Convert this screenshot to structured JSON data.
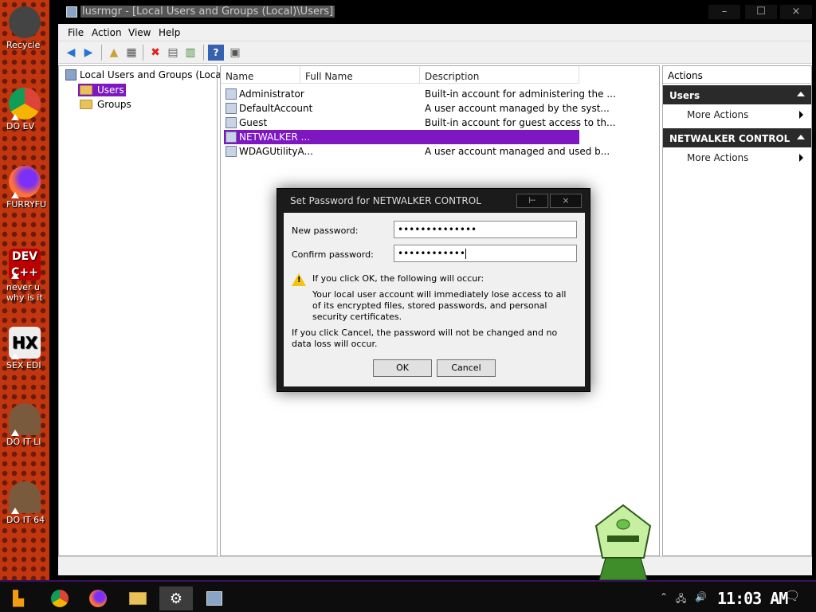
{
  "desktop": {
    "icons": [
      {
        "label": "Recycle"
      },
      {
        "label": "DO EV"
      },
      {
        "label": "FURRYFU"
      },
      {
        "label": "never u"
      },
      {
        "label": "why is it"
      },
      {
        "label": "SEX EDI"
      },
      {
        "label": "DO IT LI"
      },
      {
        "label": "DO IT 64"
      }
    ]
  },
  "window": {
    "title": "lusrmgr - [Local Users and Groups (Local)\\Users]",
    "controls": {
      "minimize": "–",
      "maximize": "☐",
      "close": "×"
    },
    "menu": [
      "File",
      "Action",
      "View",
      "Help"
    ],
    "toolbar_icons": [
      "back-arrow-icon",
      "forward-arrow-icon",
      "up-folder-icon",
      "show-hide-tree-icon",
      "delete-icon",
      "properties-icon",
      "export-list-icon",
      "help-icon",
      "show-hide-action-pane-icon"
    ]
  },
  "tree": {
    "root": "Local Users and Groups (Local)",
    "items": [
      {
        "label": "Users",
        "selected": true
      },
      {
        "label": "Groups",
        "selected": false
      }
    ]
  },
  "list": {
    "columns": [
      "Name",
      "Full Name",
      "Description"
    ],
    "rows": [
      {
        "name": "Administrator",
        "full_name": "",
        "description": "Built-in account for administering the ..."
      },
      {
        "name": "DefaultAccount",
        "full_name": "",
        "description": "A user account managed by the syst..."
      },
      {
        "name": "Guest",
        "full_name": "",
        "description": "Built-in account for guest access to th..."
      },
      {
        "name": "NETWALKER ...",
        "full_name": "",
        "description": "",
        "selected": true
      },
      {
        "name": "WDAGUtilityA...",
        "full_name": "",
        "description": "A user account managed and used b..."
      }
    ]
  },
  "actions": {
    "header": "Actions",
    "groups": [
      {
        "title": "Users",
        "item": "More Actions"
      },
      {
        "title": "NETWALKER CONTROL",
        "item": "More Actions"
      }
    ]
  },
  "dialog": {
    "title": "Set Password for NETWALKER CONTROL",
    "new_password_label": "New password:",
    "new_password_value": "••••••••••••••",
    "confirm_password_label": "Confirm password:",
    "confirm_password_value": "••••••••••••",
    "warning_heading": "If you click OK, the following will occur:",
    "warning_body": "Your local user account will immediately lose access to all of its encrypted files, stored passwords, and personal security certificates.",
    "cancel_note": "If you click Cancel, the password will not be changed and no data loss will occur.",
    "ok_label": "OK",
    "cancel_label": "Cancel",
    "help_btn": "⊢",
    "close_btn": "×"
  },
  "taskbar": {
    "clock": "11:03 AM",
    "apps": [
      "start-icon",
      "chrome-icon",
      "firefox-icon",
      "file-explorer-icon",
      "settings-icon",
      "lusrmgr-icon"
    ]
  },
  "colors": {
    "selection": "#7e16c1",
    "desktop": "#c1360f",
    "window_frame": "#000000"
  }
}
